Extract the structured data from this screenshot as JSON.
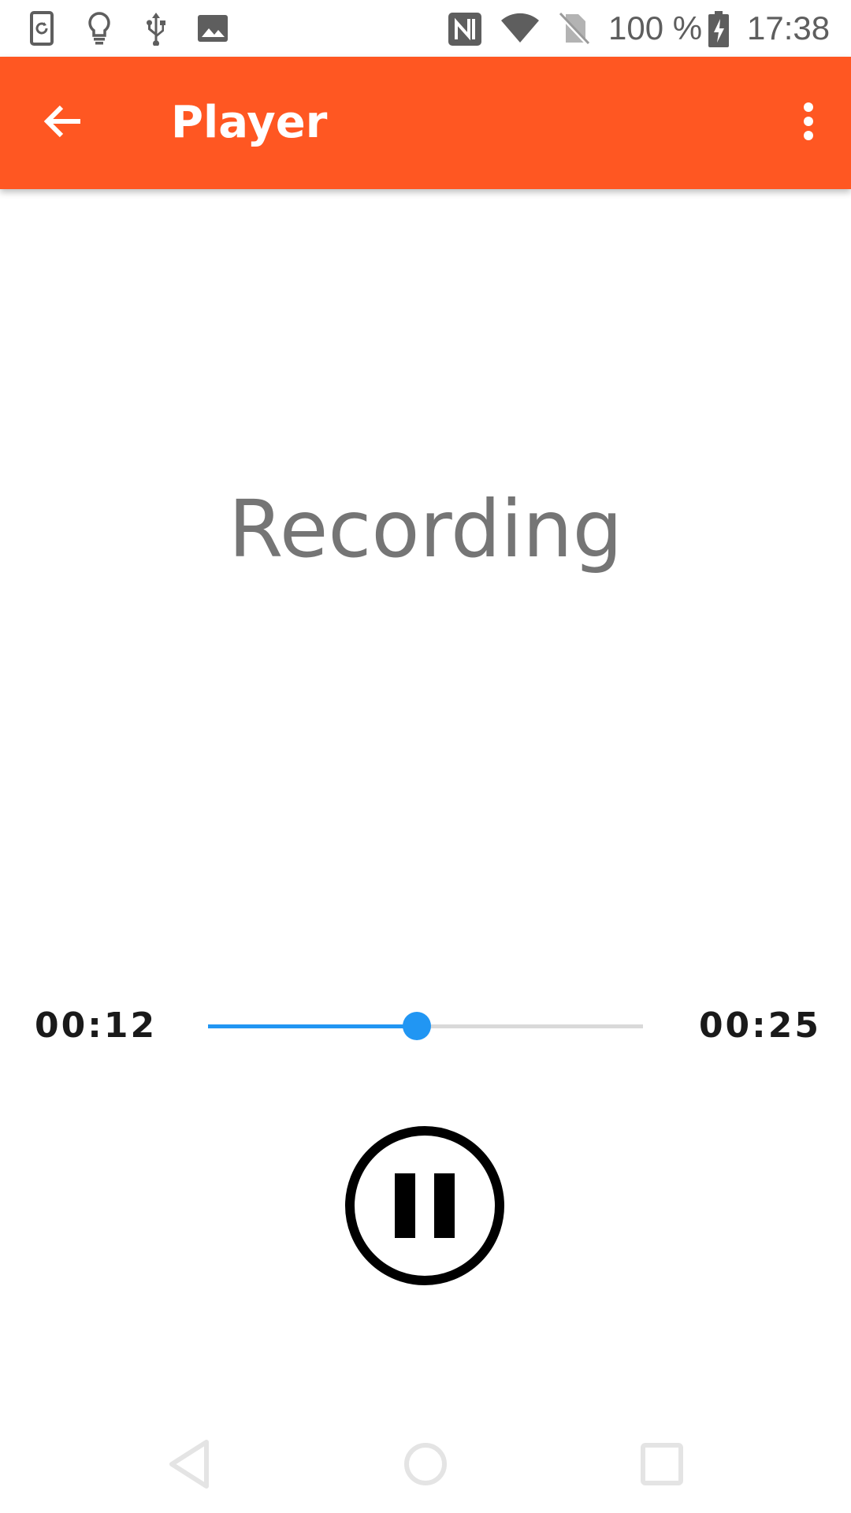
{
  "status_bar": {
    "left_icons": [
      "screen-rotation-icon",
      "bulb-icon",
      "usb-icon",
      "image-icon"
    ],
    "right_icons": [
      "nfc-icon",
      "wifi-icon",
      "no-sim-icon",
      "battery-charging-icon"
    ],
    "battery": "100 %",
    "time": "17:38"
  },
  "app_bar": {
    "title": "Player",
    "back_icon": "arrow-back-icon",
    "menu_icon": "more-vert-icon",
    "color": "#ff5722"
  },
  "player": {
    "title": "Recording",
    "elapsed": "00:12",
    "total": "00:25",
    "progress": 0.48,
    "accent_color": "#2196f3",
    "control_icon": "pause-circle-icon"
  },
  "nav_bar": {
    "icons": [
      "nav-back-icon",
      "nav-home-icon",
      "nav-recents-icon"
    ]
  }
}
